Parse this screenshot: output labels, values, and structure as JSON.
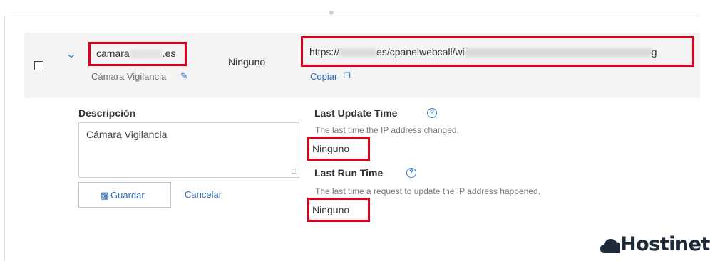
{
  "row": {
    "domain_prefix": "camara",
    "domain_suffix": ".es",
    "description_label": "Cámara Vigilancia",
    "status": "Ninguno",
    "url_start": "https://",
    "url_middle": "es/cpanelwebcall/wi",
    "url_end": "g",
    "copy_label": "Copiar"
  },
  "panel": {
    "description_heading": "Descripción",
    "description_value": "Cámara Vigilancia",
    "save_label": "Guardar",
    "cancel_label": "Cancelar",
    "last_update": {
      "heading": "Last Update Time",
      "hint": "The last time the IP address changed.",
      "value": "Ninguno"
    },
    "last_run": {
      "heading": "Last Run Time",
      "hint": "The last time a request to update the IP address happened.",
      "value": "Ninguno"
    }
  },
  "brand": {
    "name": "Hostinet",
    "logo_text": "Hostinet"
  },
  "colors": {
    "highlight": "#e0001b",
    "link": "#2d6db6",
    "row_bg": "#f4f4f4"
  }
}
